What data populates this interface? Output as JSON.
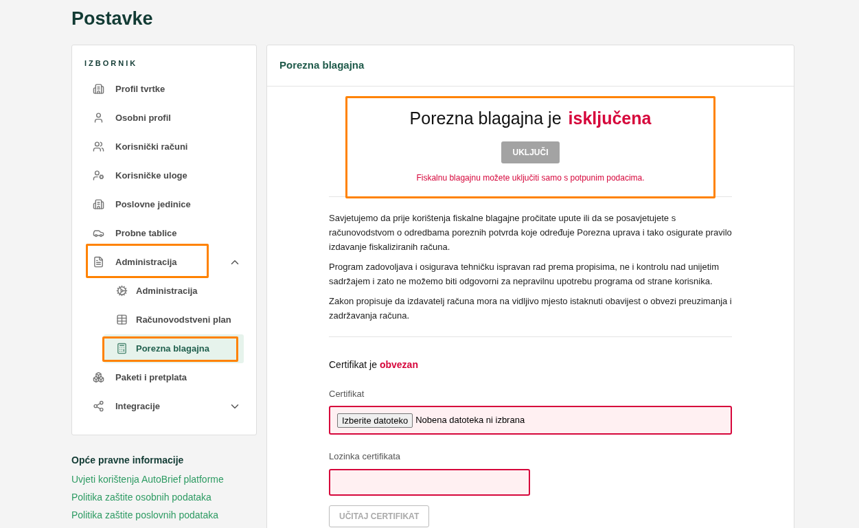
{
  "page_title": "Postavke",
  "sidebar": {
    "heading": "IZBORNIK",
    "items": [
      {
        "label": "Profil tvrtke",
        "selected": false,
        "highlighted": false
      },
      {
        "label": "Osobni profil",
        "selected": false,
        "highlighted": false
      },
      {
        "label": "Korisnički računi",
        "selected": false,
        "highlighted": false
      },
      {
        "label": "Korisničke uloge",
        "selected": false,
        "highlighted": false
      },
      {
        "label": "Poslovne jedinice",
        "selected": false,
        "highlighted": false
      },
      {
        "label": "Probne tablice",
        "selected": false,
        "highlighted": false
      },
      {
        "label": "Administracija",
        "selected": false,
        "highlighted": true,
        "expanded": true,
        "children": [
          {
            "label": "Administracija",
            "selected": false,
            "highlighted": false
          },
          {
            "label": "Računovodstveni plan",
            "selected": false,
            "highlighted": false
          },
          {
            "label": "Porezna blagajna",
            "selected": true,
            "highlighted": true
          }
        ]
      },
      {
        "label": "Paketi i pretplata",
        "selected": false,
        "highlighted": false
      },
      {
        "label": "Integracije",
        "selected": false,
        "highlighted": false,
        "expanded": false
      }
    ]
  },
  "legal": {
    "title": "Opće pravne informacije",
    "links": [
      "Uvjeti korištenja AutoBrief platforme",
      "Politika zaštite osobnih podataka",
      "Politika zaštite poslovnih podataka"
    ]
  },
  "panel": {
    "title": "Porezna blagajna",
    "status": {
      "text": "Porezna blagajna je",
      "state": "isključena",
      "highlighted": true,
      "button": {
        "label": "UKLJUČI",
        "disabled": true
      },
      "message": "Fiskalnu blagajnu možete uključiti samo s potpunim podacima."
    },
    "paragraphs": [
      "Savjetujemo da prije korištenja fiskalne blagajne pročitate upute ili da se posavjetujete s računovodstvom o odredbama poreznih potvrda koje određuje Porezna uprava i tako osigurate pravilo izdavanje fiskaliziranih računa.",
      "Program zadovoljava i osigurava tehničku ispravan rad prema propisima, ne i kontrolu nad unijetim sadržajem i zato ne možemo biti odgovorni za nepravilnu upotrebu programa od strane korisnika.",
      "Zakon propisuje da izdavatelj računa mora na vidljivo mjesto istaknuti obavijest o obvezi preuzimanja i zadržavanja računa."
    ],
    "certificate": {
      "text": "Certifikat je",
      "requirement": "obvezan",
      "fields": [
        {
          "kind": "file",
          "label": "Certifikat",
          "button": "Izberite datoteko",
          "value": "Nobena datoteka ni izbrana",
          "invalid": true
        },
        {
          "kind": "password",
          "label": "Lozinka certifikata",
          "invalid": true
        }
      ],
      "submit": {
        "label": "UČITAJ CERTIFIKAT",
        "disabled": true
      }
    }
  }
}
